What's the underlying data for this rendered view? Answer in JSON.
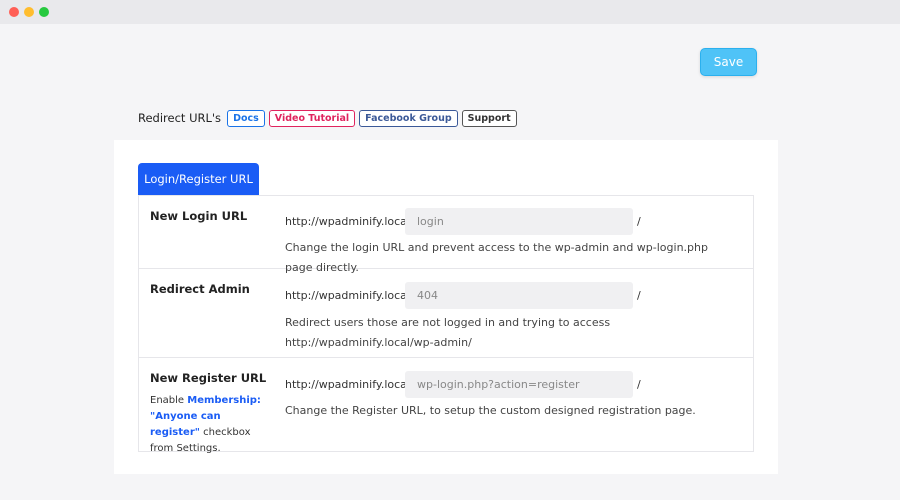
{
  "window": {
    "controls": [
      "close",
      "minimize",
      "maximize"
    ]
  },
  "toolbar": {
    "save_label": "Save"
  },
  "links": {
    "title": "Redirect URL's",
    "docs": "Docs",
    "video": "Video Tutorial",
    "facebook": "Facebook Group",
    "support": "Support"
  },
  "tabs": [
    {
      "label": "Login/Register URL",
      "active": true
    }
  ],
  "rows": [
    {
      "label": "New Login URL",
      "prefix": "http://wpadminify.local/",
      "value": "login",
      "suffix": "/",
      "help": "Change the login URL and prevent access to the wp-admin and wp-login.php page directly."
    },
    {
      "label": "Redirect Admin",
      "prefix": "http://wpadminify.local/",
      "value": "404",
      "suffix": "/",
      "help": "Redirect users those are not logged in and trying to access http://wpadminify.local/wp-admin/"
    },
    {
      "label": "New Register URL",
      "desc_pre": "Enable ",
      "desc_link": "Membership: \"Anyone can register\"",
      "desc_post": " checkbox from Settings.",
      "prefix": "http://wpadminify.local/",
      "value": "wp-login.php?action=register",
      "suffix": "/",
      "help": "Change the Register URL, to setup the custom designed registration page."
    }
  ],
  "colors": {
    "accent": "#1a5cf5",
    "save": "#4fc3f7"
  }
}
